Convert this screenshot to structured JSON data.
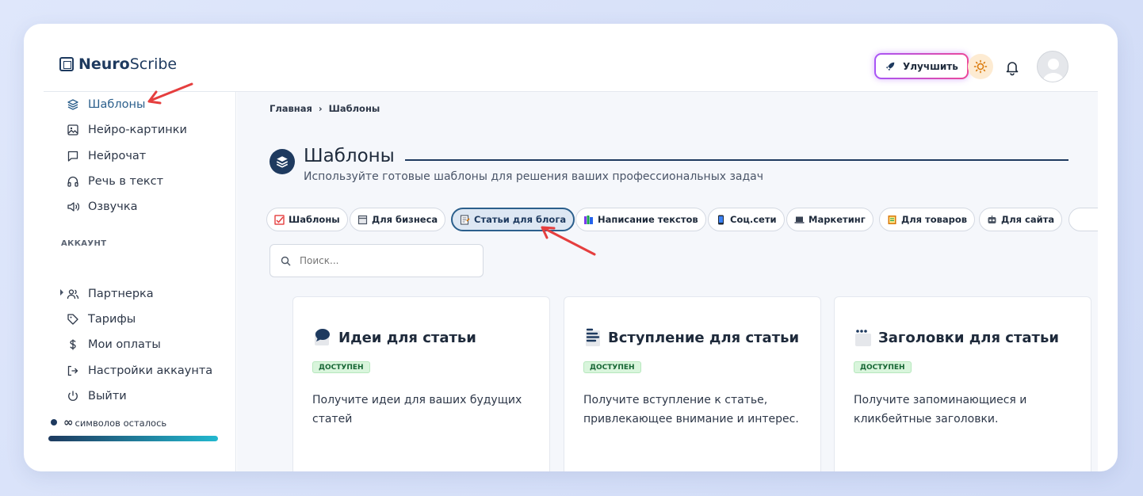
{
  "header": {
    "logo_bold": "Neuro",
    "logo_rest": "Scribe",
    "upgrade_label": "Улучшить"
  },
  "sidebar": {
    "items": [
      {
        "label": "Шаблоны",
        "icon": "layers-icon",
        "active": true
      },
      {
        "label": "Нейро-картинки",
        "icon": "image-icon"
      },
      {
        "label": "Нейрочат",
        "icon": "chat-icon"
      },
      {
        "label": "Речь в текст",
        "icon": "headphones-icon"
      },
      {
        "label": "Озвучка",
        "icon": "speaker-icon"
      }
    ],
    "account_label": "АККАУНТ",
    "account_items": [
      {
        "label": "Партнерка",
        "icon": "users-icon"
      },
      {
        "label": "Тарифы",
        "icon": "tag-icon"
      },
      {
        "label": "Мои оплаты",
        "icon": "dollar-icon"
      },
      {
        "label": "Настройки аккаунта",
        "icon": "logout-arrow-icon"
      },
      {
        "label": "Выйти",
        "icon": "power-icon"
      }
    ],
    "credits_symbol": "∞",
    "credits_text": "символов осталось",
    "credits_progress": 1.0
  },
  "breadcrumb": {
    "home": "Главная",
    "separator": "›",
    "current": "Шаблоны"
  },
  "page": {
    "title": "Шаблоны",
    "subtitle": "Используйте готовые шаблоны для решения ваших профессиональных задач"
  },
  "chips": [
    {
      "label": "Шаблоны",
      "icon": "checkbox-icon",
      "color": "#e53e3e"
    },
    {
      "label": "Для бизнеса",
      "icon": "building-icon",
      "color": "#4b5563"
    },
    {
      "label": "Статьи для блога",
      "icon": "memo-icon",
      "color": "#6b7280",
      "active": true
    },
    {
      "label": "Написание текстов",
      "icon": "books-icon",
      "color": "#7c3aed"
    },
    {
      "label": "Соц.сети",
      "icon": "phone-icon",
      "color": "#1f2937"
    },
    {
      "label": "Маркетинг",
      "icon": "laptop-icon",
      "color": "#374151"
    },
    {
      "label": "Для товаров",
      "icon": "ledger-icon",
      "color": "#d97706"
    },
    {
      "label": "Для сайта",
      "icon": "robot-icon",
      "color": "#4b5563"
    }
  ],
  "search": {
    "placeholder": "Поиск..."
  },
  "cards": [
    {
      "title": "Идеи для статьи",
      "icon": "speech-bubble-icon",
      "badge": "ДОСТУПЕН",
      "description": "Получите идеи для ваших будущих статей"
    },
    {
      "title": "Вступление для статьи",
      "icon": "text-lines-icon",
      "badge": "ДОСТУПЕН",
      "description": "Получите вступление к статье, привлекающее внимание и интерес."
    },
    {
      "title": "Заголовки для статьи",
      "icon": "window-dots-icon",
      "badge": "ДОСТУПЕН",
      "description": "Получите запоминающиеся и кликбейтные заголовки."
    }
  ],
  "colors": {
    "accent": "#1e3a5f",
    "active_text": "#2b5f8c",
    "annotation_arrow": "#e53e3e",
    "badge_bg": "#d9f5dc"
  }
}
